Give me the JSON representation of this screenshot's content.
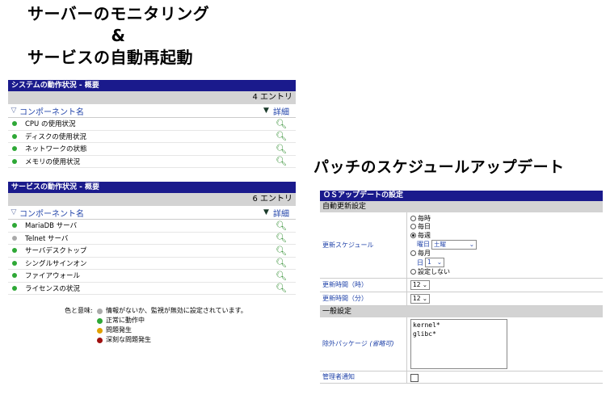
{
  "title": {
    "line1": "サーバーのモニタリング",
    "line2": "&",
    "line3": "サービスの自動再起動"
  },
  "patch_title": "パッチのスケジュールアップデート",
  "system_panel": {
    "header": "システムの動作状況 - 概要",
    "count": "4 エントリ",
    "col_name": "コンポーネント名",
    "col_detail": "詳細",
    "rows": [
      "CPU の使用状況",
      "ディスクの使用状況",
      "ネットワークの状態",
      "メモリの使用状況"
    ]
  },
  "service_panel": {
    "header": "サービスの動作状況 - 概要",
    "count": "6 エントリ",
    "col_name": "コンポーネント名",
    "col_detail": "詳細",
    "rows": [
      "MariaDB サーバ",
      "Telnet サーバ",
      "サーバデスクトップ",
      "シングルサインオン",
      "ファイアウォール",
      "ライセンスの状況"
    ]
  },
  "legend": {
    "label": "色と意味:",
    "items": [
      "情報がないか、監視が無効に設定されています。",
      "正常に動作中",
      "問題発生",
      "深刻な問題発生"
    ],
    "colors": [
      "#aaaaaa",
      "#2ea836",
      "#e0a000",
      "#a01010"
    ]
  },
  "os_panel": {
    "header": "ＯＳアップデートの設定",
    "section_auto": "自動更新設定",
    "schedule_label": "更新スケジュール",
    "opt_hourly": "毎時",
    "opt_daily": "毎日",
    "opt_weekly": "毎週",
    "weekday_label": "曜日",
    "weekday_value": "土曜",
    "opt_monthly": "毎月",
    "day_label": "日",
    "day_value": "1",
    "opt_none": "設定しない",
    "hour_label": "更新時間（時）",
    "hour_value": "12",
    "minute_label": "更新時間（分）",
    "minute_value": "12",
    "section_general": "一般設定",
    "exclude_label": "除外パッケージ",
    "exclude_optional": "(省略可)",
    "exclude_line1": "kernel*",
    "exclude_line2": "glibc*",
    "notify_label": "管理者通知"
  }
}
